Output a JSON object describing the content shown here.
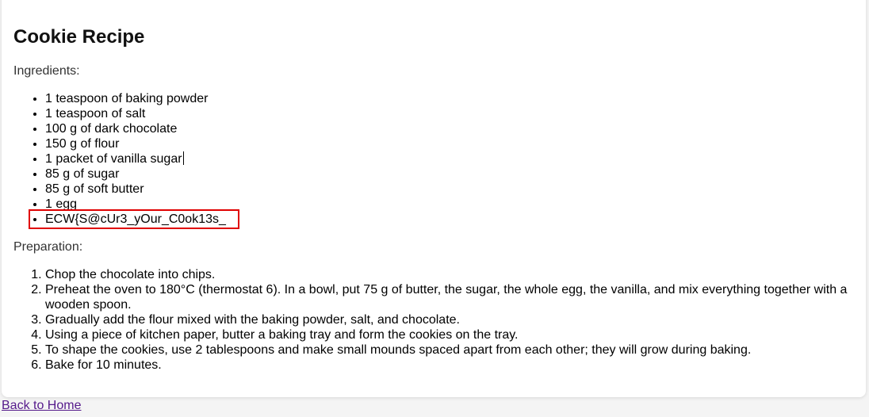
{
  "recipe": {
    "title": "Cookie Recipe",
    "ingredients_label": "Ingredients:",
    "ingredients": [
      "1 teaspoon of baking powder",
      "1 teaspoon of salt",
      "100 g of dark chocolate",
      "150 g of flour",
      "1 packet of vanilla sugar",
      "85 g of sugar",
      "85 g of soft butter",
      "1 egg",
      "ECW{S@cUr3_yOur_C0ok13s_"
    ],
    "preparation_label": "Preparation:",
    "steps": [
      "Chop the chocolate into chips.",
      "Preheat the oven to 180°C (thermostat 6). In a bowl, put 75 g of butter, the sugar, the whole egg, the vanilla, and mix everything together with a wooden spoon.",
      "Gradually add the flour mixed with the baking powder, salt, and chocolate.",
      "Using a piece of kitchen paper, butter a baking tray and form the cookies on the tray.",
      "To shape the cookies, use 2 tablespoons and make small mounds spaced apart from each other; they will grow during baking.",
      "Bake for 10 minutes."
    ]
  },
  "nav": {
    "back_link": "Back to Home"
  },
  "colors": {
    "highlight_border": "#e00000",
    "link": "#551a8b"
  }
}
